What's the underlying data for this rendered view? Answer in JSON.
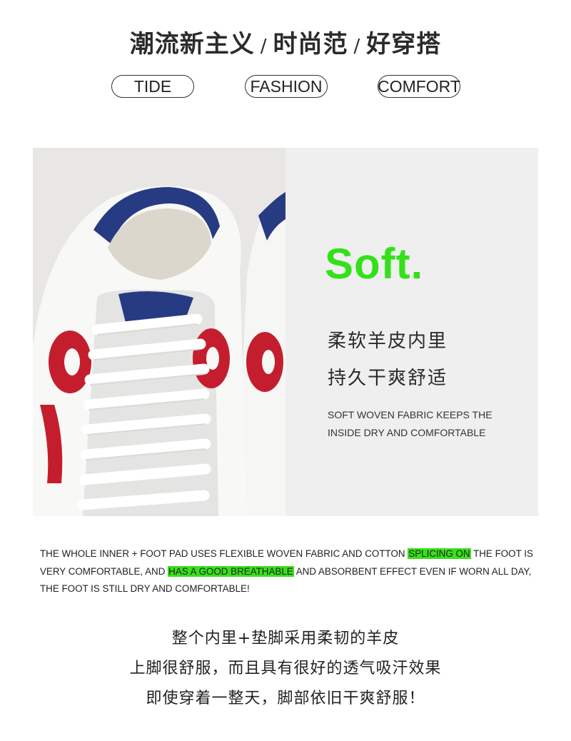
{
  "header": {
    "part1": "潮流新主义",
    "sep1": "/",
    "part2": "时尚范",
    "sep2": "/",
    "part3": "好穿搭"
  },
  "tags": [
    "TIDE",
    "FASHION",
    "COMFORT"
  ],
  "feature": {
    "title": "Soft.",
    "title_color": "#33e01a",
    "cn_line1": "柔软羊皮内里",
    "cn_line2": "持久干爽舒适",
    "en_line1": "SOFT WOVEN FABRIC KEEPS THE",
    "en_line2": "INSIDE DRY AND COMFORTABLE",
    "photo_icon": "sneaker-photo"
  },
  "description": {
    "seg1": "THE WHOLE INNER + FOOT PAD USES FLEXIBLE WOVEN FABRIC AND COTTON ",
    "hl1": "SPLICING ON",
    "seg2": " THE FOOT IS VERY COMFORTABLE, AND ",
    "hl2": "HAS A GOOD BREATHABLE",
    "seg3": " AND ABSORBENT EFFECT EVEN IF WORN ALL DAY, THE FOOT IS STILL DRY AND COMFORTABLE!",
    "highlight_color": "#39e01a"
  },
  "cn_description": [
    "整个内里+垫脚采用柔韧的羊皮",
    "上脚很舒服，而且具有很好的透气吸汗效果",
    "即使穿着一整天，脚部依旧干爽舒服！"
  ]
}
